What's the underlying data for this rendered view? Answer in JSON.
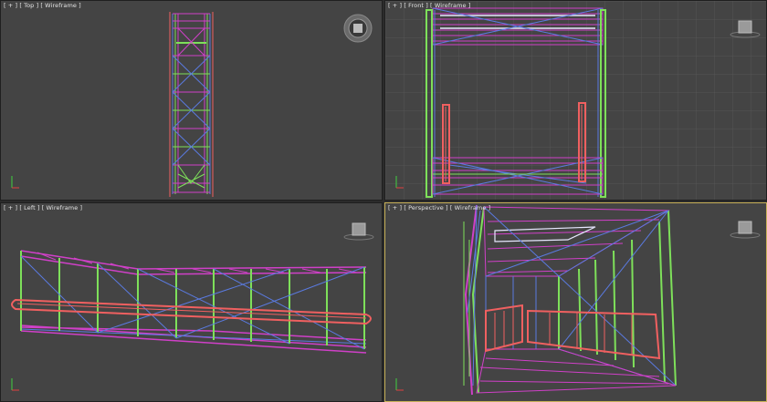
{
  "app": {
    "accent_active": "#c9b25a",
    "viewport_bg": "#444444"
  },
  "viewports": [
    {
      "id": "top",
      "label": {
        "plus": "[ + ]",
        "view": "[ Top ]",
        "mode": "[ Wireframe ]"
      },
      "nav": "viewcube-icon"
    },
    {
      "id": "front",
      "label": {
        "plus": "[ + ]",
        "view": "[ Front ]",
        "mode": "[ Wireframe ]"
      },
      "nav": "viewcube-icon"
    },
    {
      "id": "left",
      "label": {
        "plus": "[ + ]",
        "view": "[ Left ]",
        "mode": "[ Wireframe ]"
      },
      "nav": "viewcube-icon"
    },
    {
      "id": "perspective",
      "label": {
        "plus": "[ + ]",
        "view": "[ Perspective ]",
        "mode": "[ Wireframe ]"
      },
      "nav": "viewcube-icon",
      "active": true
    }
  ],
  "colors": {
    "magenta": "#d040c8",
    "green": "#7ee05a",
    "blue": "#5a7ae0",
    "red": "#f06060",
    "white": "#e8e8ff",
    "grid": "#555555"
  }
}
